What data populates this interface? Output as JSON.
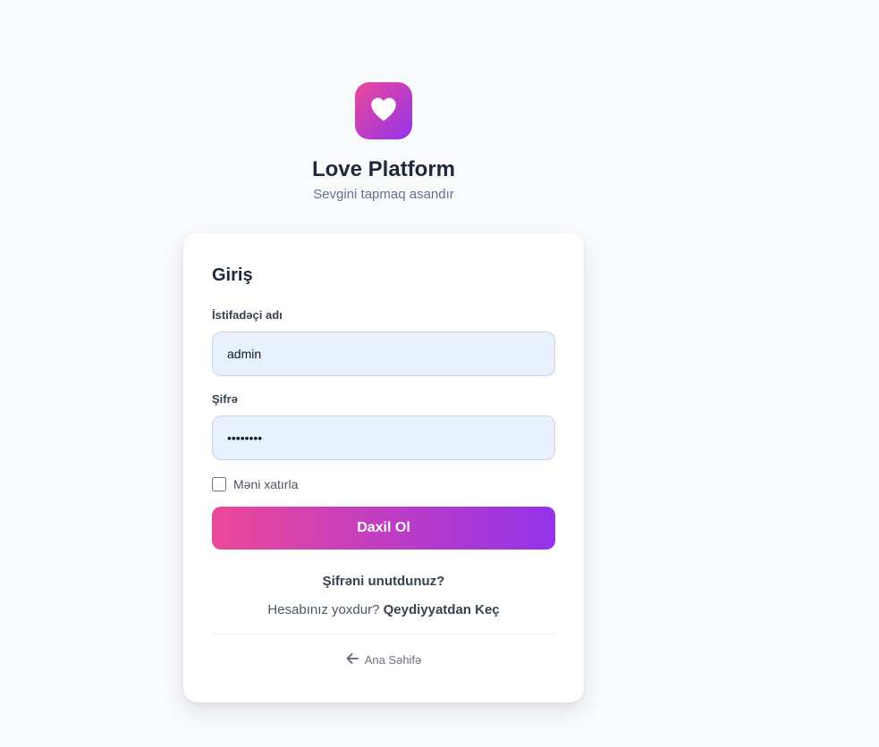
{
  "brand": {
    "title": "Love Platform",
    "subtitle": "Sevgini tapmaq asandır",
    "logo_icon": "heart-icon",
    "gradient": [
      "#ec4899",
      "#9333ea"
    ]
  },
  "login": {
    "heading": "Giriş",
    "username_label": "İstifadəçi adı",
    "username_value": "admin",
    "password_label": "Şifrə",
    "password_value": "password",
    "remember_label": "Məni xatırla",
    "remember_checked": false,
    "submit_label": "Daxil Ol",
    "forgot_label": "Şifrəni unutdunuz?",
    "signup_prompt": "Hesabınız yoxdur?",
    "signup_link": "Qeydiyyatdan Keç",
    "home_icon": "arrow-left-icon",
    "home_label": "Ana Səhifə"
  }
}
